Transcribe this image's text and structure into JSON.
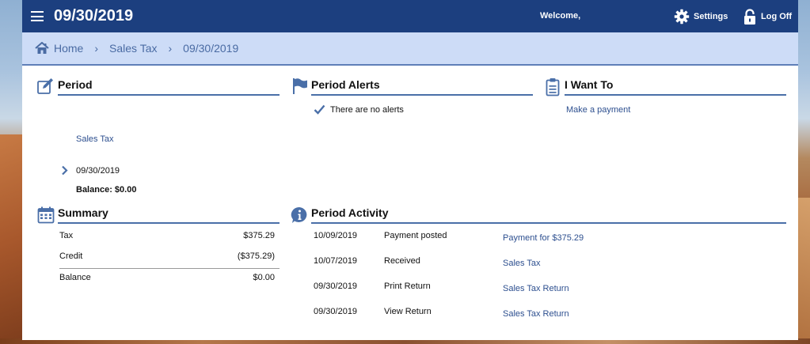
{
  "header": {
    "title": "09/30/2019",
    "welcome": "Welcome,",
    "settings_label": "Settings",
    "logoff_label": "Log Off"
  },
  "breadcrumb": [
    "Home",
    "Sales Tax",
    "09/30/2019"
  ],
  "period": {
    "heading": "Period",
    "account_link": "Sales Tax",
    "selected_period": "09/30/2019",
    "balance": "Balance: $0.00"
  },
  "alerts": {
    "heading": "Period Alerts",
    "message": "There are no alerts"
  },
  "want_to": {
    "heading": "I Want To",
    "actions": [
      "Make a payment"
    ]
  },
  "summary": {
    "heading": "Summary",
    "rows": [
      {
        "label": "Tax",
        "amount": "$375.29"
      },
      {
        "label": "Credit",
        "amount": "($375.29)"
      },
      {
        "label": "Balance",
        "amount": "$0.00"
      }
    ]
  },
  "activity": {
    "heading": "Period Activity",
    "rows": [
      {
        "date": "10/09/2019",
        "event": "Payment posted",
        "link": "Payment for $375.29"
      },
      {
        "date": "10/07/2019",
        "event": "Received",
        "link": "Sales Tax"
      },
      {
        "date": "09/30/2019",
        "event": "Print Return",
        "link": "Sales Tax Return"
      },
      {
        "date": "09/30/2019",
        "event": "View Return",
        "link": "Sales Tax Return"
      }
    ]
  },
  "colors": {
    "header_bg": "#1c3f7f",
    "breadcrumb_bg": "#cddcf7",
    "accent": "#4a6fa8",
    "link": "#2d4f8f"
  },
  "icons": [
    "menu-icon",
    "gear-icon",
    "lock-icon",
    "home-icon",
    "edit-icon",
    "flag-icon",
    "clipboard-icon",
    "check-icon",
    "chevron-right-icon",
    "calendar-icon",
    "info-icon"
  ]
}
